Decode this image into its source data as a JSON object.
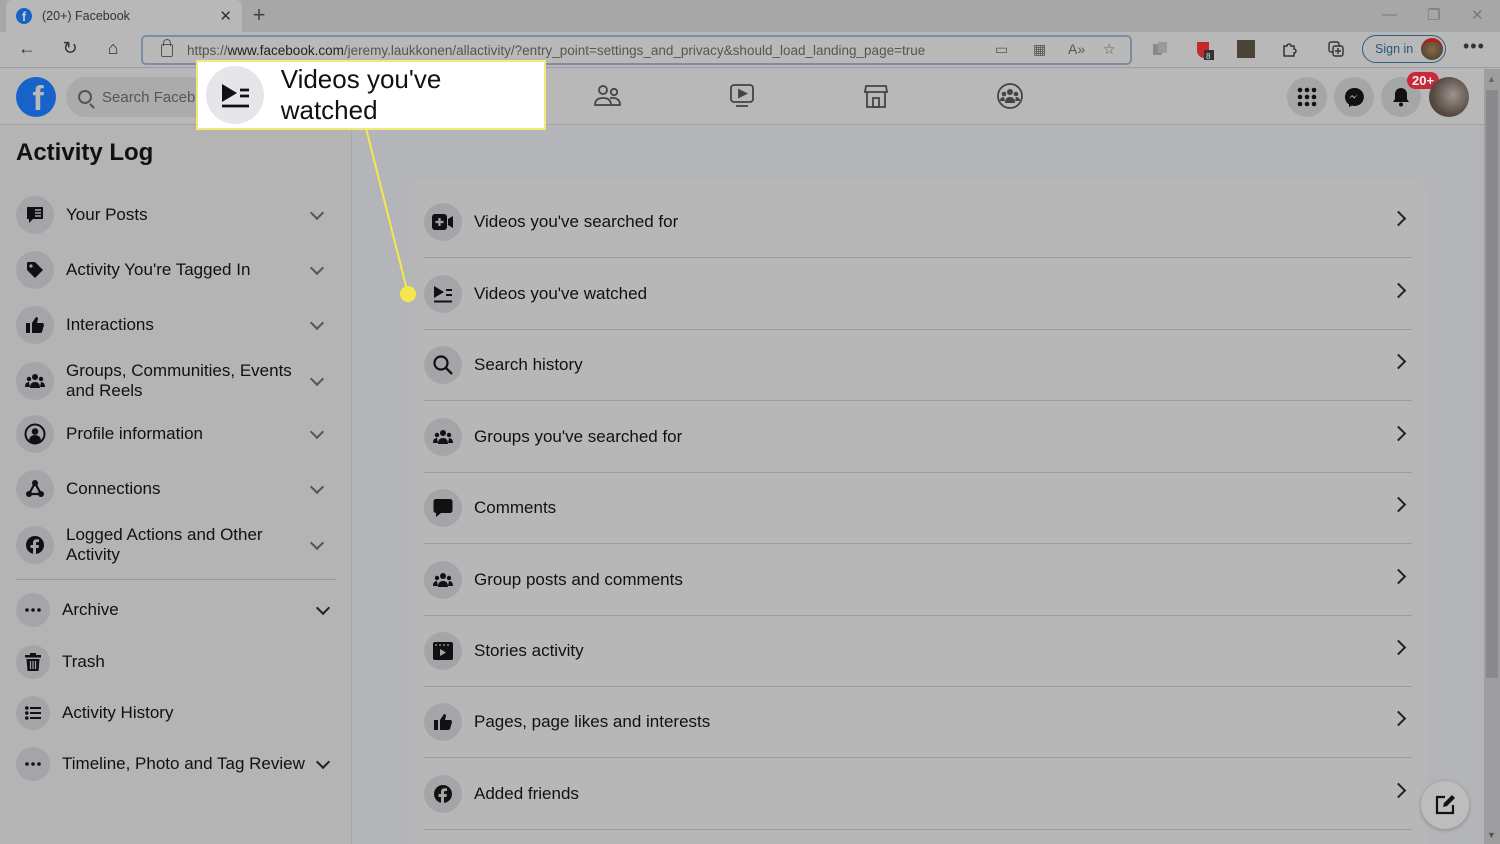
{
  "browser": {
    "tab_title": "(20+) Facebook",
    "url_prefix": "https://",
    "url_host": "www.facebook.com",
    "url_path": "/jeremy.laukkonen/allactivity/?entry_point=settings_and_privacy&should_load_landing_page=true",
    "extension_badge": "8",
    "sign_in_label": "Sign in"
  },
  "fb_header": {
    "search_placeholder": "Search Facebook",
    "notification_count": "20+"
  },
  "callout": {
    "text": "Videos you've watched",
    "highlight_color": "#f5e84a"
  },
  "sidebar": {
    "title": "Activity Log",
    "items": [
      {
        "label": "Your Posts",
        "icon": "posts-icon",
        "expandable": true
      },
      {
        "label": "Activity You're Tagged In",
        "icon": "tag-icon",
        "expandable": true
      },
      {
        "label": "Interactions",
        "icon": "thumbs-up-icon",
        "expandable": true
      },
      {
        "label": "Groups, Communities, Events and Reels",
        "icon": "groups-icon",
        "expandable": true
      },
      {
        "label": "Profile information",
        "icon": "profile-icon",
        "expandable": true
      },
      {
        "label": "Connections",
        "icon": "connections-icon",
        "expandable": true
      },
      {
        "label": "Logged Actions and Other Activity",
        "icon": "facebook-icon",
        "expandable": true
      }
    ],
    "secondary_items": [
      {
        "label": "Archive",
        "icon": "more-dots-icon",
        "expandable": true
      },
      {
        "label": "Trash",
        "icon": "trash-icon",
        "expandable": false
      },
      {
        "label": "Activity History",
        "icon": "list-icon",
        "expandable": false
      },
      {
        "label": "Timeline, Photo and Tag Review",
        "icon": "more-dots-icon",
        "expandable": true
      }
    ]
  },
  "main": {
    "items": [
      {
        "label": "Videos you've searched for",
        "icon": "video-add-icon"
      },
      {
        "label": "Videos you've watched",
        "icon": "video-watched-icon"
      },
      {
        "label": "Search history",
        "icon": "search-icon"
      },
      {
        "label": "Groups you've searched for",
        "icon": "groups-icon"
      },
      {
        "label": "Comments",
        "icon": "comment-icon"
      },
      {
        "label": "Group posts and comments",
        "icon": "groups-icon"
      },
      {
        "label": "Stories activity",
        "icon": "stories-icon"
      },
      {
        "label": "Pages, page likes and interests",
        "icon": "thumbs-up-icon"
      },
      {
        "label": "Added friends",
        "icon": "facebook-icon"
      }
    ]
  }
}
